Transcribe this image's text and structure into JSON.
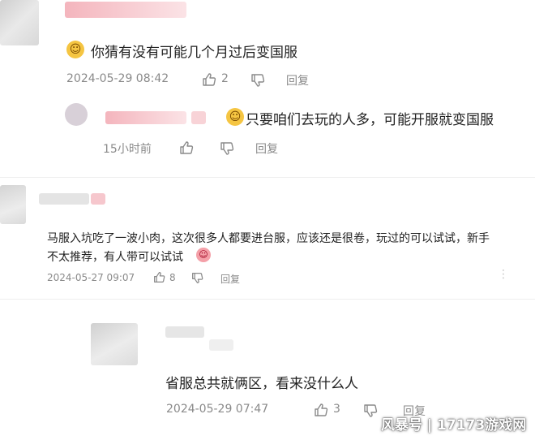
{
  "comments": [
    {
      "text": "你猜有没有可能几个月过后变国服",
      "timestamp": "2024-05-29 08:42",
      "like_count": "2",
      "reply_label": "回复",
      "emoji_icon": "cat-face-icon",
      "replies": [
        {
          "text": "只要咱们去玩的人多，可能开服就变国服",
          "timestamp": "15小时前",
          "reply_label": "回复",
          "emoji_icon": "cat-face-icon"
        }
      ]
    },
    {
      "text_line1": "马服入坑吃了一波小肉，这次很多人都要进台服，应该还是很卷，玩过的可以试试，新手",
      "text_line2": "不太推荐，有人带可以试试",
      "timestamp": "2024-05-27 09:07",
      "like_count": "8",
      "reply_label": "回复",
      "emoji_icon": "shy-face-icon"
    },
    {
      "text": "省服总共就俩区，看来没什么人",
      "timestamp": "2024-05-29 07:47",
      "like_count": "3",
      "reply_label": "回复"
    }
  ],
  "watermark": "风暴号 | 17173游戏网",
  "colors": {
    "meta_gray": "#8a8a8a",
    "blur_pink": "#f7c9cf",
    "blur_gray": "#d6d6d6"
  }
}
